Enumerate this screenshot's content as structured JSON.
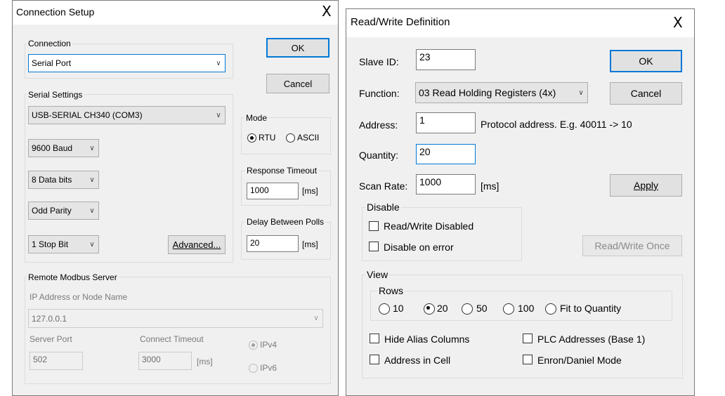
{
  "connection_setup": {
    "title": "Connection Setup",
    "close_glyph": "X",
    "connection_group": "Connection",
    "connection_value": "Serial Port",
    "ok_label": "OK",
    "cancel_label": "Cancel",
    "serial_group": "Serial Settings",
    "port_value": "USB-SERIAL CH340 (COM3)",
    "baud_value": "9600 Baud",
    "databits_value": "8 Data bits",
    "parity_value": "Odd Parity",
    "stopbit_value": "1 Stop Bit",
    "advanced_label": "Advanced...",
    "mode_group": "Mode",
    "mode_rtu": "RTU",
    "mode_ascii": "ASCII",
    "mode_selected": "RTU",
    "response_timeout_group": "Response Timeout",
    "response_timeout_value": "1000",
    "response_timeout_unit": "[ms]",
    "delay_polls_group": "Delay Between Polls",
    "delay_polls_value": "20",
    "delay_polls_unit": "[ms]",
    "remote_group": "Remote Modbus Server",
    "ip_label": "IP Address or Node Name",
    "ip_value": "127.0.0.1",
    "server_port_label": "Server Port",
    "server_port_value": "502",
    "connect_timeout_label": "Connect Timeout",
    "connect_timeout_value": "3000",
    "connect_timeout_unit": "[ms]",
    "ipv4_label": "IPv4",
    "ipv6_label": "IPv6"
  },
  "rw_definition": {
    "title": "Read/Write Definition",
    "close_glyph": "X",
    "slave_id_label": "Slave ID:",
    "slave_id_value": "23",
    "function_label": "Function:",
    "function_value": "03 Read Holding Registers (4x)",
    "address_label": "Address:",
    "address_value": "1",
    "address_hint": "Protocol address. E.g. 40011 -> 10",
    "quantity_label": "Quantity:",
    "quantity_value": "20",
    "scan_rate_label": "Scan Rate:",
    "scan_rate_value": "1000",
    "scan_rate_unit": "[ms]",
    "ok_label": "OK",
    "cancel_label": "Cancel",
    "apply_label": "Apply",
    "disable_group": "Disable",
    "rw_disabled_label": "Read/Write Disabled",
    "disable_on_error_label": "Disable on error",
    "rw_once_label": "Read/Write Once",
    "view_group": "View",
    "rows_group": "Rows",
    "rows_options": [
      "10",
      "20",
      "50",
      "100",
      "Fit to Quantity"
    ],
    "rows_selected": "20",
    "hide_alias_label": "Hide Alias Columns",
    "plc_addresses_label": "PLC Addresses (Base 1)",
    "address_in_cell_label": "Address in Cell",
    "enron_label": "Enron/Daniel Mode"
  }
}
